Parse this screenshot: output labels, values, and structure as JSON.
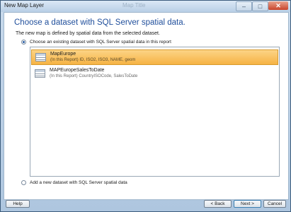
{
  "window": {
    "title": "New Map Layer",
    "background_title": "Map Title",
    "controls": {
      "minimize": "–",
      "maximize": "□",
      "close": "✕"
    }
  },
  "wizard": {
    "heading": "Choose a dataset with SQL Server spatial data.",
    "subtitle": "The new map is defined by spatial data from the selected dataset.",
    "option_existing": "Choose an existing dataset with SQL Server spatial data in this report",
    "option_new": "Add a new dataset with SQL Server spatial data",
    "selected_option": "existing",
    "datasets": [
      {
        "name": "MapEurope",
        "meta": "(In this Report) ID, ISO2, ISO3, NAME, geom",
        "selected": true
      },
      {
        "name": "MAPEuropeSalesToDate",
        "meta": "(In this Report) CountryISOCode, SalesToDate",
        "selected": false
      }
    ]
  },
  "buttons": {
    "help": "Help",
    "back": "< Back",
    "next": "Next >",
    "cancel": "Cancel"
  },
  "colors": {
    "heading": "#1f4e9b",
    "selection": "#f6b344"
  }
}
